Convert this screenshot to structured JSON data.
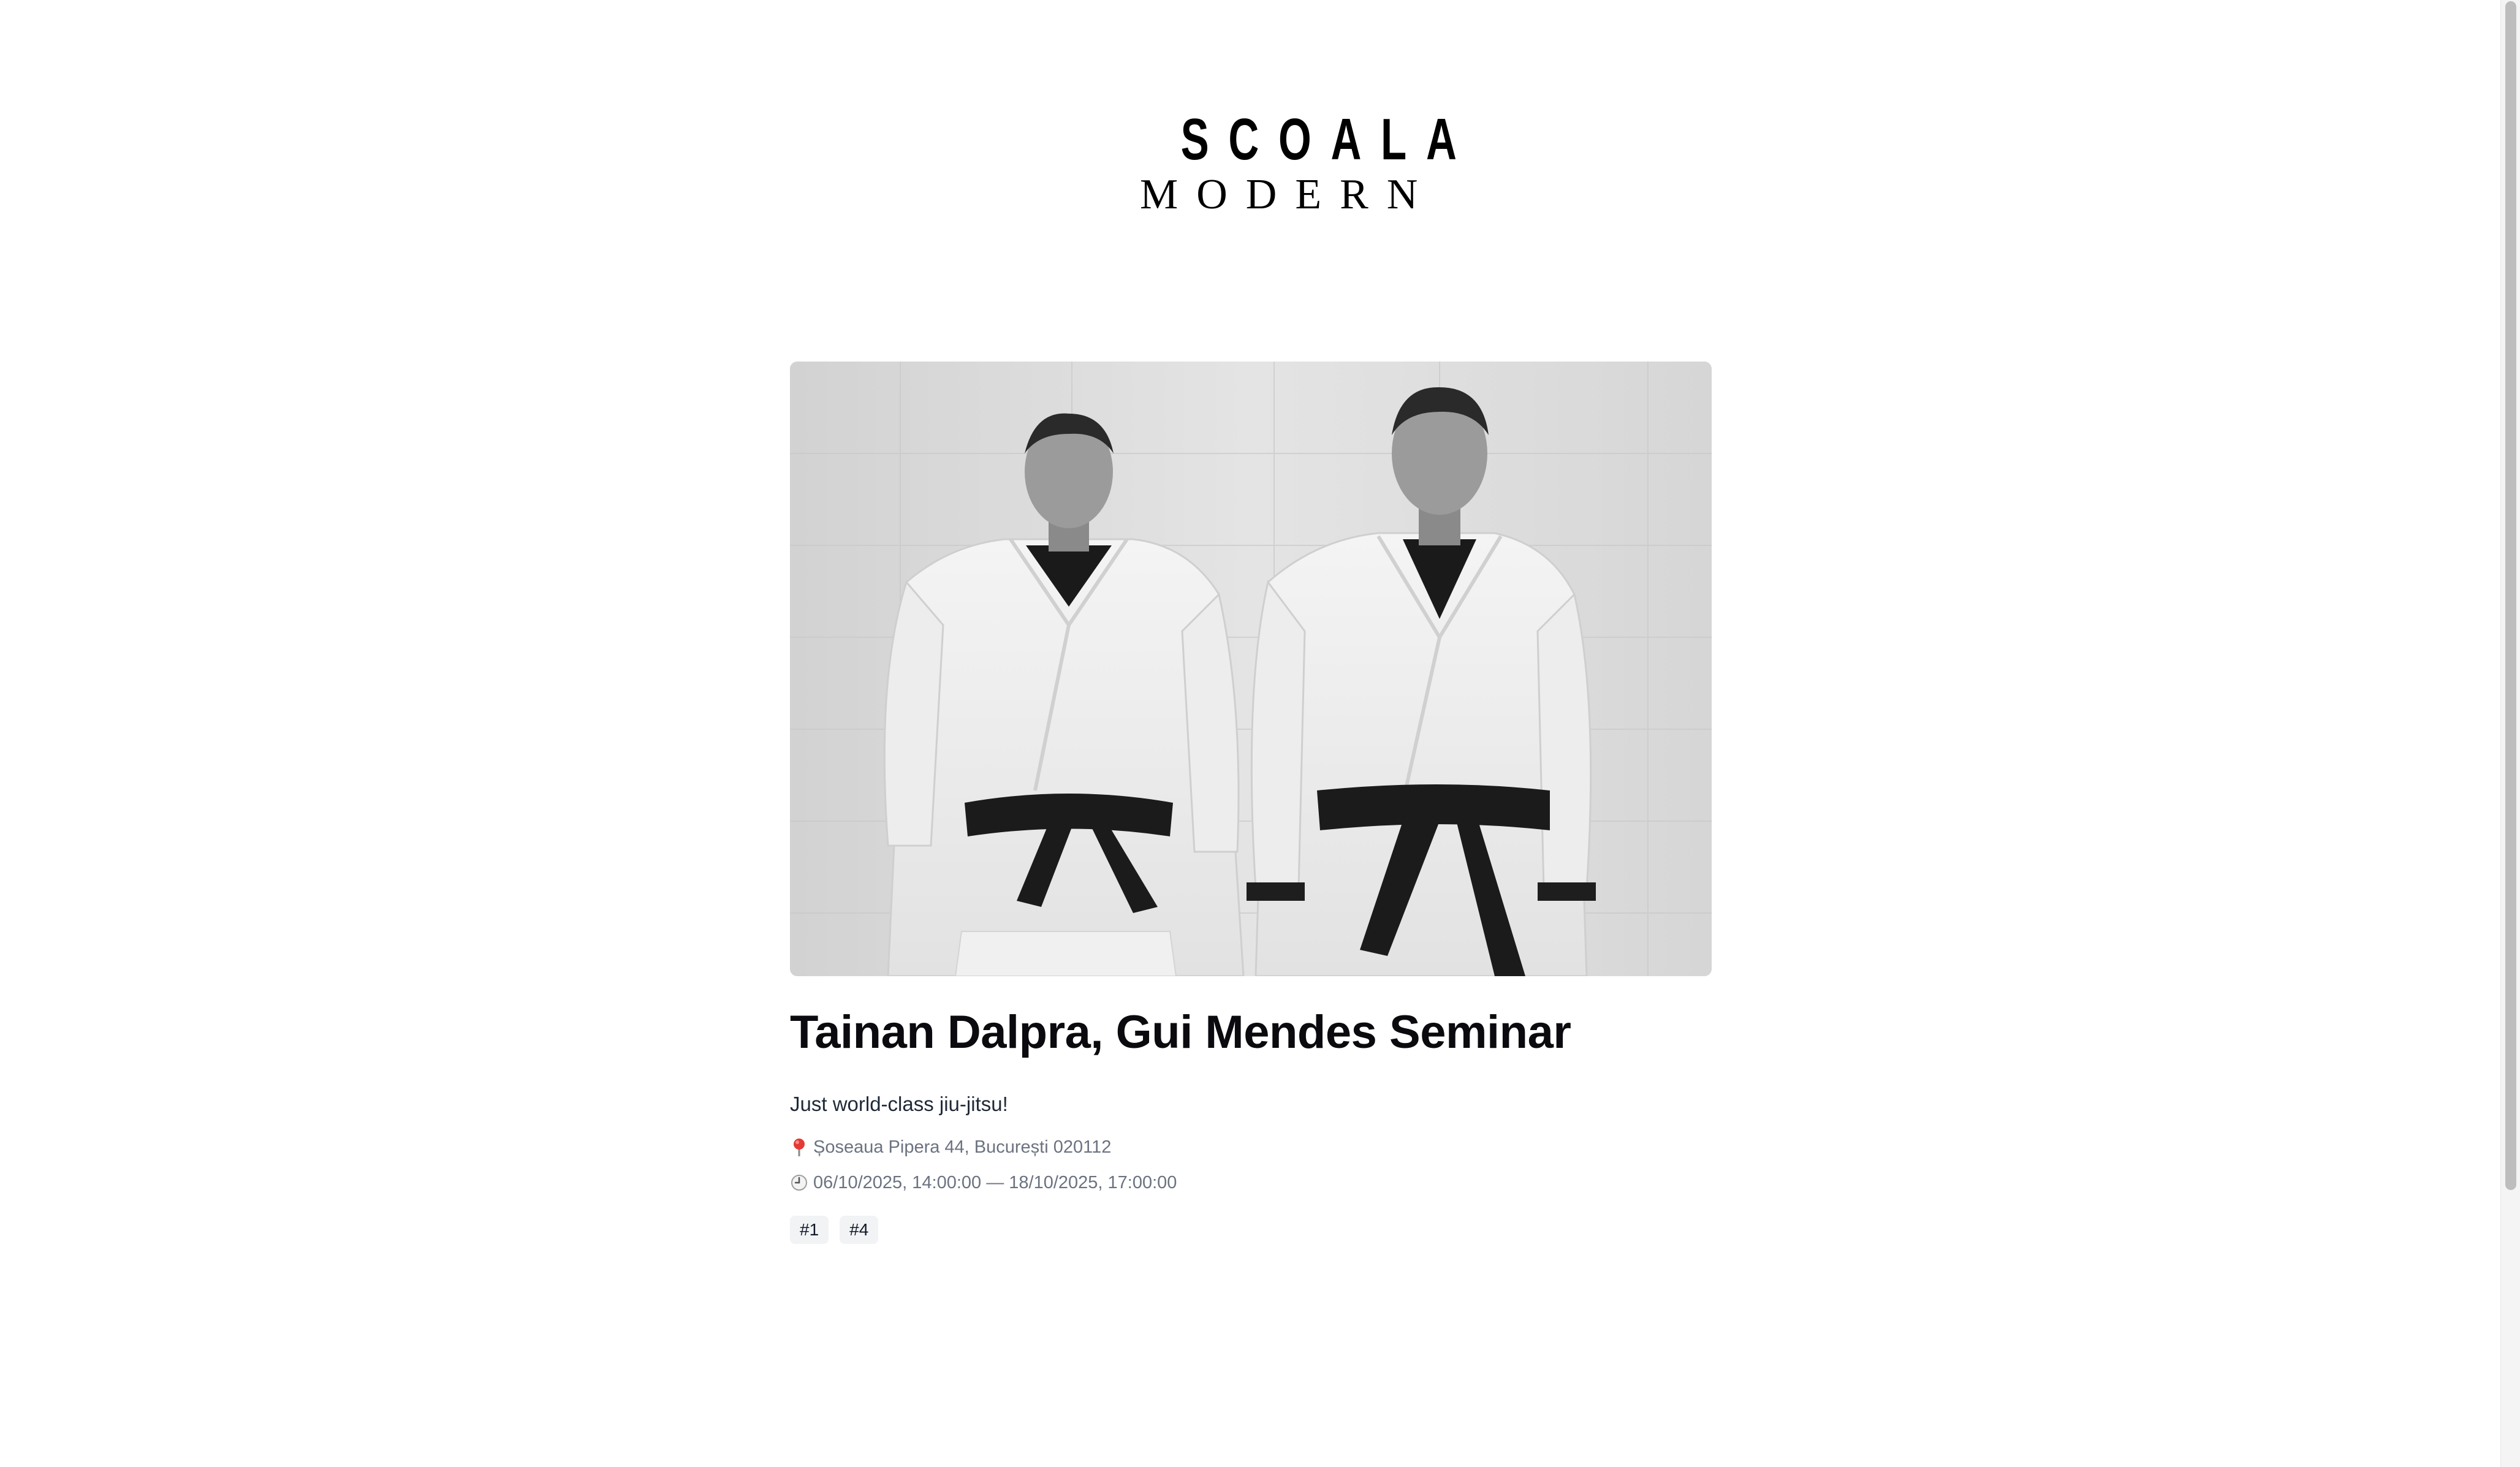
{
  "logo": {
    "line1": "SCOALA",
    "line2": "MODERN"
  },
  "hero": {
    "image": "seminar-instructors-photo"
  },
  "event": {
    "title": "Tainan Dalpra, Gui Mendes Seminar",
    "description": "Just world-class jiu-jitsu!",
    "location_icon": "pin-icon",
    "location": "Șoseaua Pipera 44, București 020112",
    "datetime_icon": "clock-icon",
    "datetime": "06/10/2025, 14:00:00 — 18/10/2025, 17:00:00",
    "tags": [
      "#1",
      "#4"
    ]
  },
  "colors": {
    "background": "#ffffff",
    "title": "#0b0b0f",
    "meta": "#6b7280",
    "tag_bg": "#f1f3f5"
  }
}
